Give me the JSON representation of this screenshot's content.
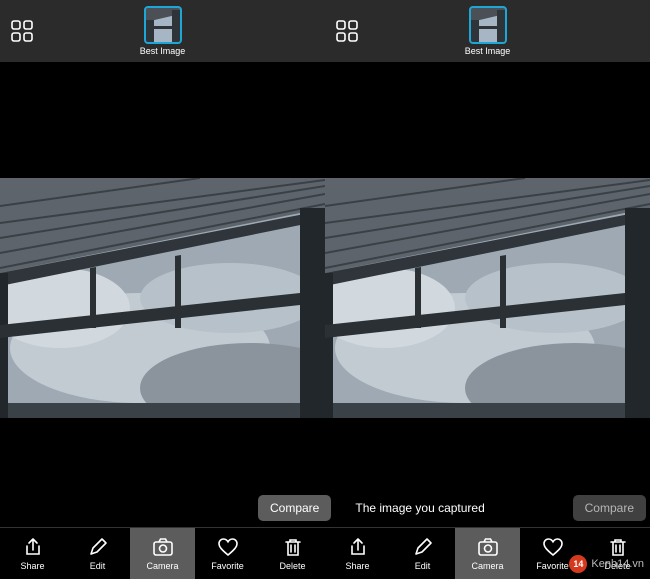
{
  "thumb_label": "Best Image",
  "compare_label": "Compare",
  "caption": "The image you captured",
  "toolbar": [
    {
      "name": "share-button",
      "label": "Share",
      "icon": "share",
      "active": false
    },
    {
      "name": "edit-button",
      "label": "Edit",
      "icon": "edit",
      "active": false
    },
    {
      "name": "camera-button",
      "label": "Camera",
      "icon": "camera",
      "active": true
    },
    {
      "name": "favorite-button",
      "label": "Favorite",
      "icon": "heart",
      "active": false
    },
    {
      "name": "delete-button",
      "label": "Delete",
      "icon": "trash",
      "active": false
    },
    {
      "name": "share-button",
      "label": "Share",
      "icon": "share",
      "active": false
    },
    {
      "name": "edit-button",
      "label": "Edit",
      "icon": "edit",
      "active": false
    },
    {
      "name": "camera-button",
      "label": "Camera",
      "icon": "camera",
      "active": true
    },
    {
      "name": "favorite-button",
      "label": "Favorite",
      "icon": "heart",
      "active": false
    },
    {
      "name": "delete-button",
      "label": "Delete",
      "icon": "trash",
      "active": false
    }
  ],
  "watermark": {
    "badge": "14",
    "text": "Kenh14.vn"
  }
}
